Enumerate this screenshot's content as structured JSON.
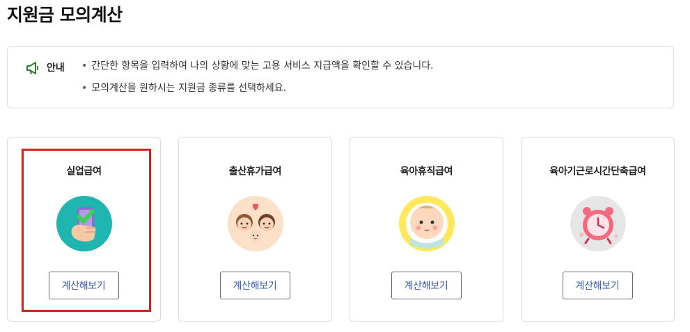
{
  "page": {
    "title": "지원금 모의계산"
  },
  "notice": {
    "icon": "megaphone-icon",
    "label": "안내",
    "lines": [
      "간단한 항목을 입력하여 나의 상황에 맞는 고용 서비스 지급액을 확인할 수 있습니다.",
      "모의계산을 원하시는 지원금 종류를 선택하세요."
    ]
  },
  "cards": [
    {
      "title": "실업급여",
      "illustration": "phone-checkmark-icon",
      "button": "계산해보기",
      "highlighted": true
    },
    {
      "title": "출산휴가급여",
      "illustration": "parents-baby-icon",
      "button": "계산해보기",
      "highlighted": false
    },
    {
      "title": "육아휴직급여",
      "illustration": "baby-face-icon",
      "button": "계산해보기",
      "highlighted": false
    },
    {
      "title": "육아기근로시간단축급여",
      "illustration": "alarm-clock-icon",
      "button": "계산해보기",
      "highlighted": false
    }
  ],
  "colors": {
    "highlight": "#d61f1f",
    "button_text": "#3b5bb5",
    "notice_icon": "#2e7d32",
    "unemployment_bg": "#1fb5b0",
    "maternity_bg": "#fde0c8",
    "parental_bg": "#ffe85c",
    "reduced_hours_bg": "#e6e6e6"
  }
}
